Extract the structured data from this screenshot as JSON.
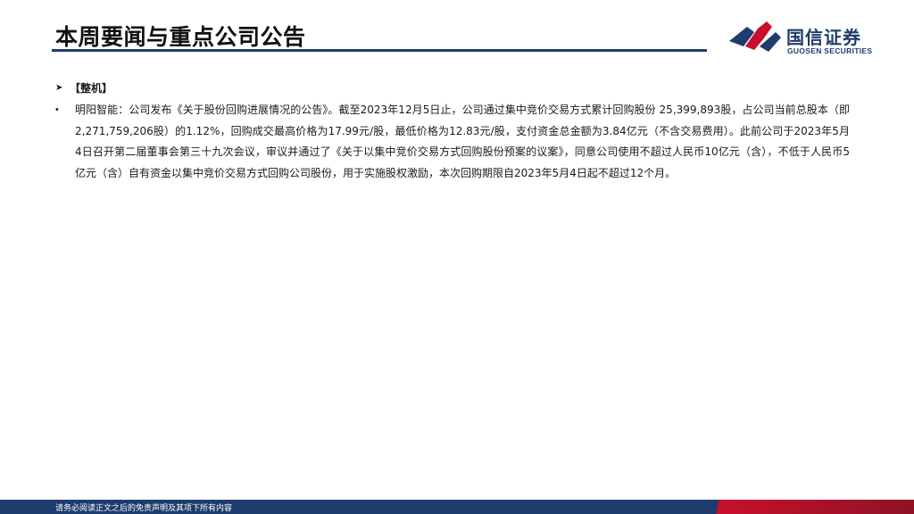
{
  "header": {
    "title": "本周要闻与重点公司公告"
  },
  "logo": {
    "name_cn": "国信证券",
    "name_en": "GUOSEN SECURITIES",
    "colors": {
      "navy": "#1e3c6e",
      "red": "#c8102e"
    }
  },
  "content": {
    "section_label": "【整机】",
    "items": [
      {
        "text": "明阳智能：公司发布《关于股份回购进展情况的公告》。截至2023年12月5日止，公司通过集中竞价交易方式累计回购股份 25,399,893股，占公司当前总股本（即2,271,759,206股）的1.12%，回购成交最高价格为17.99元/股，最低价格为12.83元/股，支付资金总金额为3.84亿元（不含交易费用）。此前公司于2023年5月4日召开第二届董事会第三十九次会议，审议并通过了《关于以集中竞价交易方式回购股份预案的议案》，同意公司使用不超过人民币10亿元（含），不低于人民币5亿元（含）自有资金以集中竞价交易方式回购公司股份，用于实施股权激励，本次回购期限自2023年5月4日起不超过12个月。"
      }
    ]
  },
  "footer": {
    "disclaimer": "请务必阅读正文之后的免责声明及其项下所有内容"
  }
}
